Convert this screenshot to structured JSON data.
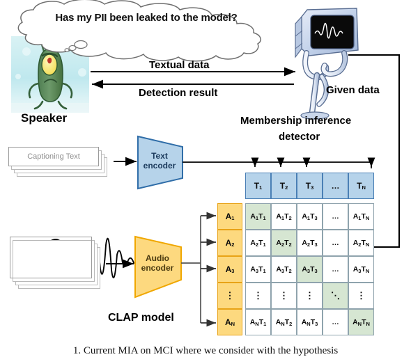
{
  "figure": {
    "thought_bubble": "Has my PII been leaked to the model?",
    "caption": "1.  Current MIA on MCI where we consider with the hypothesis"
  },
  "actors": {
    "speaker_label": "Speaker",
    "detector_label_line1": "Membership inference",
    "detector_label_line2": "detector"
  },
  "arrows": {
    "textual_data": "Textual data",
    "detection_result": "Detection result",
    "given_data": "Given data"
  },
  "inputs": {
    "text_card_label": "Captioning Text",
    "audio_card_label": ""
  },
  "encoders": {
    "text_line1": "Text",
    "text_line2": "encoder",
    "audio_line1": "Audio",
    "audio_line2": "encoder",
    "model_label": "CLAP model"
  },
  "matrix": {
    "text_headers": [
      {
        "base": "T",
        "sub": "1"
      },
      {
        "base": "T",
        "sub": "2"
      },
      {
        "base": "T",
        "sub": "3"
      },
      {
        "base": "…",
        "sub": ""
      },
      {
        "base": "T",
        "sub": "N"
      }
    ],
    "audio_headers": [
      {
        "base": "A",
        "sub": "1"
      },
      {
        "base": "A",
        "sub": "2"
      },
      {
        "base": "A",
        "sub": "3"
      },
      {
        "base": "⋮",
        "sub": ""
      },
      {
        "base": "A",
        "sub": "N"
      }
    ],
    "cells": [
      [
        "A1T1",
        "A1T2",
        "A1T3",
        "…",
        "A1TN"
      ],
      [
        "A2T1",
        "A2T2",
        "A2T3",
        "…",
        "A2TN"
      ],
      [
        "A3T1",
        "A3T2",
        "A3T3",
        "…",
        "A3TN"
      ],
      [
        "⋮",
        "⋮",
        "⋮",
        "⋱",
        "⋮"
      ],
      [
        "ANT1",
        "ANT2",
        "ANT3",
        "…",
        "ANTN"
      ]
    ]
  },
  "colors": {
    "text_blue_fill": "#b6d3ea",
    "text_blue_stroke": "#4a7fb5",
    "audio_yellow_fill": "#fdd97f",
    "audio_yellow_stroke": "#e8a317",
    "diagonal_green": "#d6e6d2",
    "cell_stroke": "#8fa3ad",
    "water_bg": "#cfeef2"
  }
}
